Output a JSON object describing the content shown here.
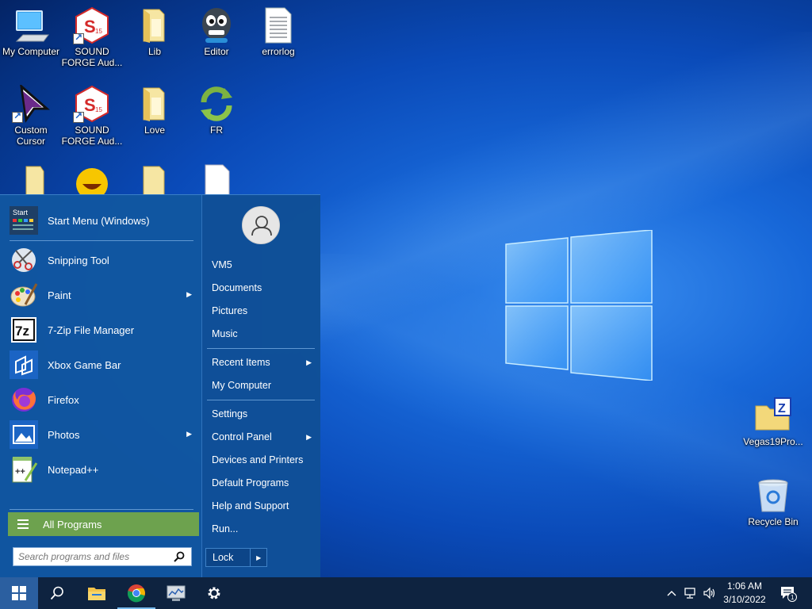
{
  "desktop": {
    "icons": [
      {
        "label": "My Computer",
        "icon": "computer-icon"
      },
      {
        "label": "SOUND FORGE Aud...",
        "icon": "sound-forge-icon",
        "badge": "15"
      },
      {
        "label": "Lib",
        "icon": "folder-icon"
      },
      {
        "label": "Editor",
        "icon": "editor-face-icon"
      },
      {
        "label": "errorlog",
        "icon": "text-file-icon"
      },
      {
        "label": "Custom Cursor",
        "icon": "cursor-icon"
      },
      {
        "label": "SOUND FORGE Aud...",
        "icon": "sound-forge-icon",
        "badge": "15"
      },
      {
        "label": "Love",
        "icon": "folder-icon"
      },
      {
        "label": "FR",
        "icon": "sync-arrows-icon"
      },
      {
        "label": "Vegas19Pro...",
        "icon": "zip-folder-icon"
      },
      {
        "label": "Recycle Bin",
        "icon": "recycle-bin-icon"
      }
    ]
  },
  "start_menu": {
    "programs": [
      {
        "label": "Start Menu (Windows)",
        "icon": "start-menu-app-icon",
        "tile_text": "Start",
        "submenu": false
      },
      {
        "label": "Snipping Tool",
        "icon": "snipping-tool-icon",
        "submenu": false
      },
      {
        "label": "Paint",
        "icon": "paint-icon",
        "submenu": true
      },
      {
        "label": "7-Zip File Manager",
        "icon": "seven-zip-icon",
        "tile_text": "7z",
        "submenu": false
      },
      {
        "label": "Xbox Game Bar",
        "icon": "xbox-game-bar-icon",
        "submenu": false
      },
      {
        "label": "Firefox",
        "icon": "firefox-icon",
        "submenu": false
      },
      {
        "label": "Photos",
        "icon": "photos-icon",
        "submenu": true
      },
      {
        "label": "Notepad++",
        "icon": "notepad-plus-plus-icon",
        "submenu": false
      }
    ],
    "all_programs": "All Programs",
    "search_placeholder": "Search programs and files",
    "right": [
      {
        "label": "VM5",
        "submenu": false
      },
      {
        "label": "Documents",
        "submenu": false
      },
      {
        "label": "Pictures",
        "submenu": false
      },
      {
        "label": "Music",
        "submenu": false
      },
      {
        "label": "Recent Items",
        "submenu": true
      },
      {
        "label": "My Computer",
        "submenu": false
      },
      {
        "label": "Settings",
        "submenu": false
      },
      {
        "label": "Control Panel",
        "submenu": true
      },
      {
        "label": "Devices and Printers",
        "submenu": false
      },
      {
        "label": "Default Programs",
        "submenu": false
      },
      {
        "label": "Help and Support",
        "submenu": false
      },
      {
        "label": "Run...",
        "submenu": false
      }
    ],
    "lock_label": "Lock"
  },
  "taskbar": {
    "clock_time": "1:06 AM",
    "clock_date": "3/10/2022",
    "notification_count": "1"
  },
  "colors": {
    "all_programs_bg": "#6da24e",
    "taskbar_bg": "#0e2340",
    "start_menu_bg": "#0e4e96"
  }
}
